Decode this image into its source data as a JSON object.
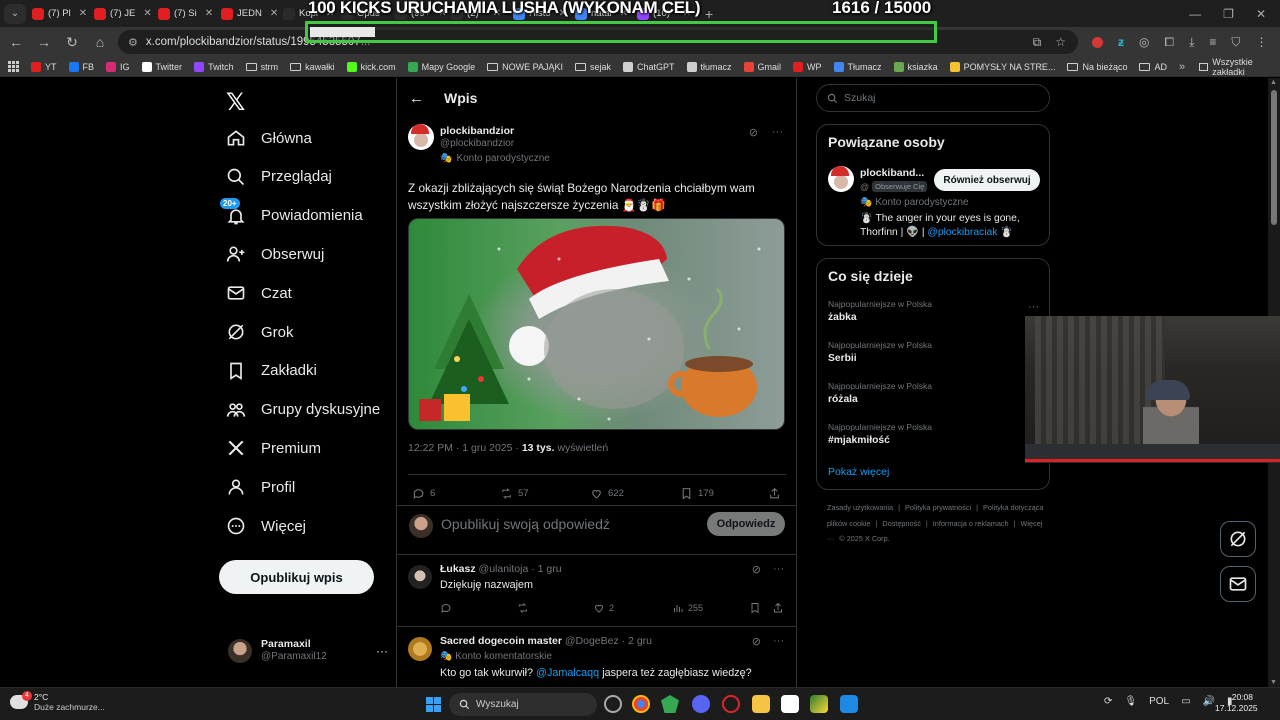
{
  "browser": {
    "tabs": [
      {
        "title": "(7) Pl",
        "color": "#e02020"
      },
      {
        "title": "(7) JE",
        "color": "#e02020"
      },
      {
        "title": "(7) Si",
        "color": "#e02020"
      },
      {
        "title": "JEDN",
        "color": "#e02020"
      },
      {
        "title": "Kopi",
        "color": "#2a2a2a"
      },
      {
        "title": "Opus",
        "color": "#2a2a2a"
      },
      {
        "title": "(99+",
        "color": "#2a2a2a"
      },
      {
        "title": "(2)",
        "color": "#2a2a2a"
      },
      {
        "title": "Histo",
        "color": "#4285f4"
      },
      {
        "title": "natal",
        "color": "#4285f4"
      },
      {
        "title": "(10)",
        "color": "#9146ff"
      }
    ],
    "url_main": "x.com/plockibandzior/status/19954535507",
    "url_rest": "...",
    "bookmarks": [
      {
        "label": "YT",
        "color": "#e02020"
      },
      {
        "label": "FB",
        "color": "#1877f2"
      },
      {
        "label": "IG",
        "color": "#d62976"
      },
      {
        "label": "Twitter",
        "color": "#ffffff"
      },
      {
        "label": "Twitch",
        "color": "#9146ff"
      },
      {
        "label": "strm",
        "folder": true
      },
      {
        "label": "kawałki",
        "folder": true
      },
      {
        "label": "kick.com",
        "color": "#53fc18"
      },
      {
        "label": "Mapy Google",
        "color": "#34a853"
      },
      {
        "label": "NOWE PAJĄKI",
        "folder": true
      },
      {
        "label": "sejak",
        "folder": true
      },
      {
        "label": "ChatGPT",
        "color": "#cfcfcf"
      },
      {
        "label": "tłumacz",
        "color": "#cfcfcf"
      },
      {
        "label": "Gmail",
        "color": "#ea4335"
      },
      {
        "label": "WP",
        "color": "#e02020"
      },
      {
        "label": "Tłumacz",
        "color": "#4285f4"
      },
      {
        "label": "ksiazka",
        "color": "#6aa84f"
      },
      {
        "label": "POMYSŁY NA STRE...",
        "color": "#f1c232"
      },
      {
        "label": "Na bieżąco",
        "folder": true
      },
      {
        "label": "AD",
        "folder": true
      }
    ],
    "all_bookmarks": "Wszystkie zakładki"
  },
  "stream_overlay": {
    "goal_text": "100 KICKS URUCHAMIA LUSHA (WYKONAM CEL)",
    "count_text": "1616 / 15000",
    "progress": 0.108
  },
  "nav": {
    "items": [
      {
        "label": "Główna",
        "icon": "home-icon"
      },
      {
        "label": "Przeglądaj",
        "icon": "search-icon"
      },
      {
        "label": "Powiadomienia",
        "icon": "bell-icon"
      },
      {
        "label": "Obserwuj",
        "icon": "follow-icon"
      },
      {
        "label": "Czat",
        "icon": "mail-icon"
      },
      {
        "label": "Grok",
        "icon": "grok-icon"
      },
      {
        "label": "Zakładki",
        "icon": "bookmark-icon"
      },
      {
        "label": "Grupy dyskusyjne",
        "icon": "communities-icon"
      },
      {
        "label": "Premium",
        "icon": "x-icon"
      },
      {
        "label": "Profil",
        "icon": "profile-icon"
      },
      {
        "label": "Więcej",
        "icon": "more-icon"
      }
    ],
    "notif_badge": "20+",
    "post_button": "Opublikuj wpis",
    "account_name": "Paramaxil",
    "account_handle": "@Paramaxil12"
  },
  "header": {
    "title": "Wpis"
  },
  "tweet": {
    "name": "plockibandzior",
    "handle": "@plockibandzior",
    "label": "Konto parodystyczne",
    "text": "Z okazji zbliżających się świąt Bożego Narodzenia chciałbym wam wszystkim złożyć najszczersze życzenia 🎅☃️🎁",
    "time": "12:22 PM · 1 gru 2025 ·",
    "views_count": "13 tys.",
    "views_label": "wyświetleń",
    "replies": "6",
    "reposts": "57",
    "likes": "622",
    "bookmarks": "179"
  },
  "reply_box": {
    "placeholder": "Opublikuj swoją odpowiedź",
    "button": "Odpowiedz"
  },
  "replies": [
    {
      "name": "Łukasz",
      "handle": "@ulanitoja",
      "date": "· 1 gru",
      "text": "Dziękuję nazwajem",
      "likes": "2",
      "views": "255"
    },
    {
      "name": "Sacred dogecoin master",
      "handle": "@DogeBez",
      "date": "· 2 gru",
      "label": "Konto komentatorskie",
      "text_before": "Kto go tak wkurwił? ",
      "mention": "@Jamalcaqq",
      "text_after": " jaspera też zagłębiasz wiedzę?"
    }
  ],
  "sidebar": {
    "search_placeholder": "Szukaj",
    "related_title": "Powiązane osoby",
    "related": {
      "name": "plockiband...",
      "handle": "@",
      "follows_you": "Obserwuje Cię",
      "button": "Również obserwuj",
      "label": "Konto parodystyczne",
      "bio_before": "☃️ The anger in your eyes is gone, Thorfinn | 👽 | ",
      "bio_mention": "@plockibraciak",
      "bio_after": " ☃️"
    },
    "trends_title": "Co się dzieje",
    "trends": [
      {
        "context": "Najpopularniejsze w Polska",
        "topic": "żabka"
      },
      {
        "context": "Najpopularniejsze w Polska",
        "topic": "Serbii"
      },
      {
        "context": "Najpopularniejsze w Polska",
        "topic": "różala"
      },
      {
        "context": "Najpopularniejsze w Polska",
        "topic": "#mjakmiłość"
      }
    ],
    "show_more": "Pokaż więcej",
    "footer": [
      "Zasady użytkowania",
      "|",
      "Polityka prywatności",
      "|",
      "Polityka dotycząca plików cookie",
      "|",
      "Dostępność",
      "|",
      "Informacja o reklamach",
      "|",
      "Więcej ···",
      "© 2025 X Corp."
    ]
  },
  "taskbar": {
    "temp": "2°C",
    "weather": "Duże zachmurze...",
    "weather_badge": "4",
    "search": "Wyszukaj",
    "lang": "POL",
    "time": "20:08",
    "date": "17.12.2025"
  }
}
